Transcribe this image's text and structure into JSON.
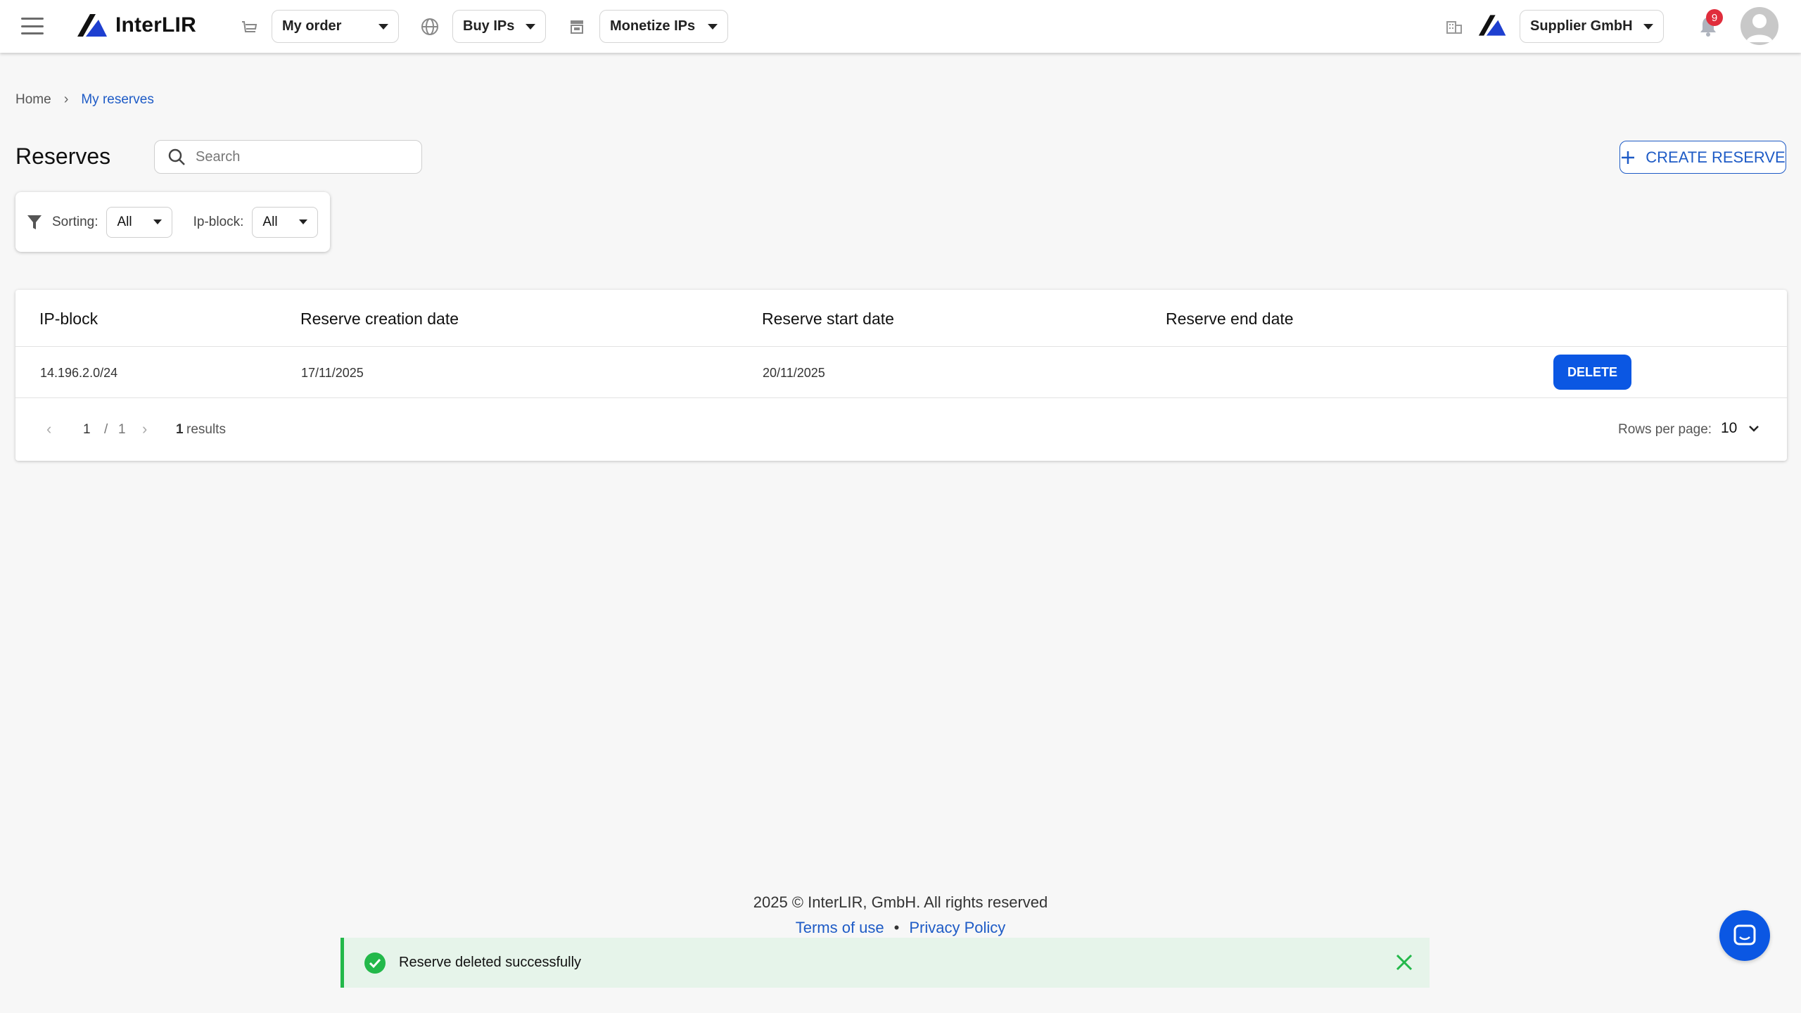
{
  "header": {
    "logo_text": "InterLIR",
    "nav": [
      {
        "label": "My order",
        "icon": "cart-icon"
      },
      {
        "label": "Buy IPs",
        "icon": "globe-icon"
      },
      {
        "label": "Monetize IPs",
        "icon": "store-icon"
      }
    ],
    "company": {
      "label": "Supplier GmbH",
      "icon": "building-icon"
    },
    "notifications_count": "9"
  },
  "breadcrumb": {
    "home": "Home",
    "current": "My reserves"
  },
  "page": {
    "title": "Reserves",
    "search_placeholder": "Search",
    "create_label": "CREATE RESERVE"
  },
  "filters": {
    "sorting_label": "Sorting:",
    "sorting_value": "All",
    "ipblock_label": "Ip-block:",
    "ipblock_value": "All"
  },
  "table": {
    "columns": [
      "IP-block",
      "Reserve creation date",
      "Reserve start date",
      "Reserve end date"
    ],
    "rows": [
      {
        "ip_block": "14.196.2.0/24",
        "creation": "17/11/2025",
        "start": "20/11/2025",
        "end": "",
        "action": "DELETE"
      }
    ],
    "pagination": {
      "page": "1",
      "sep": "/",
      "total_pages": "1",
      "results_count": "1",
      "results_label": "results",
      "rows_per_page_label": "Rows per page:",
      "rows_per_page_value": "10"
    }
  },
  "footer": {
    "copyright": "2025 © InterLIR, GmbH. All rights reserved",
    "terms": "Terms of use",
    "privacy": "Privacy Policy"
  },
  "toast": {
    "message": "Reserve deleted successfully"
  },
  "colors": {
    "accent": "#1e5bc6",
    "primary_button": "#0b57e3",
    "success": "#23b84a",
    "badge": "#e02d3c"
  }
}
